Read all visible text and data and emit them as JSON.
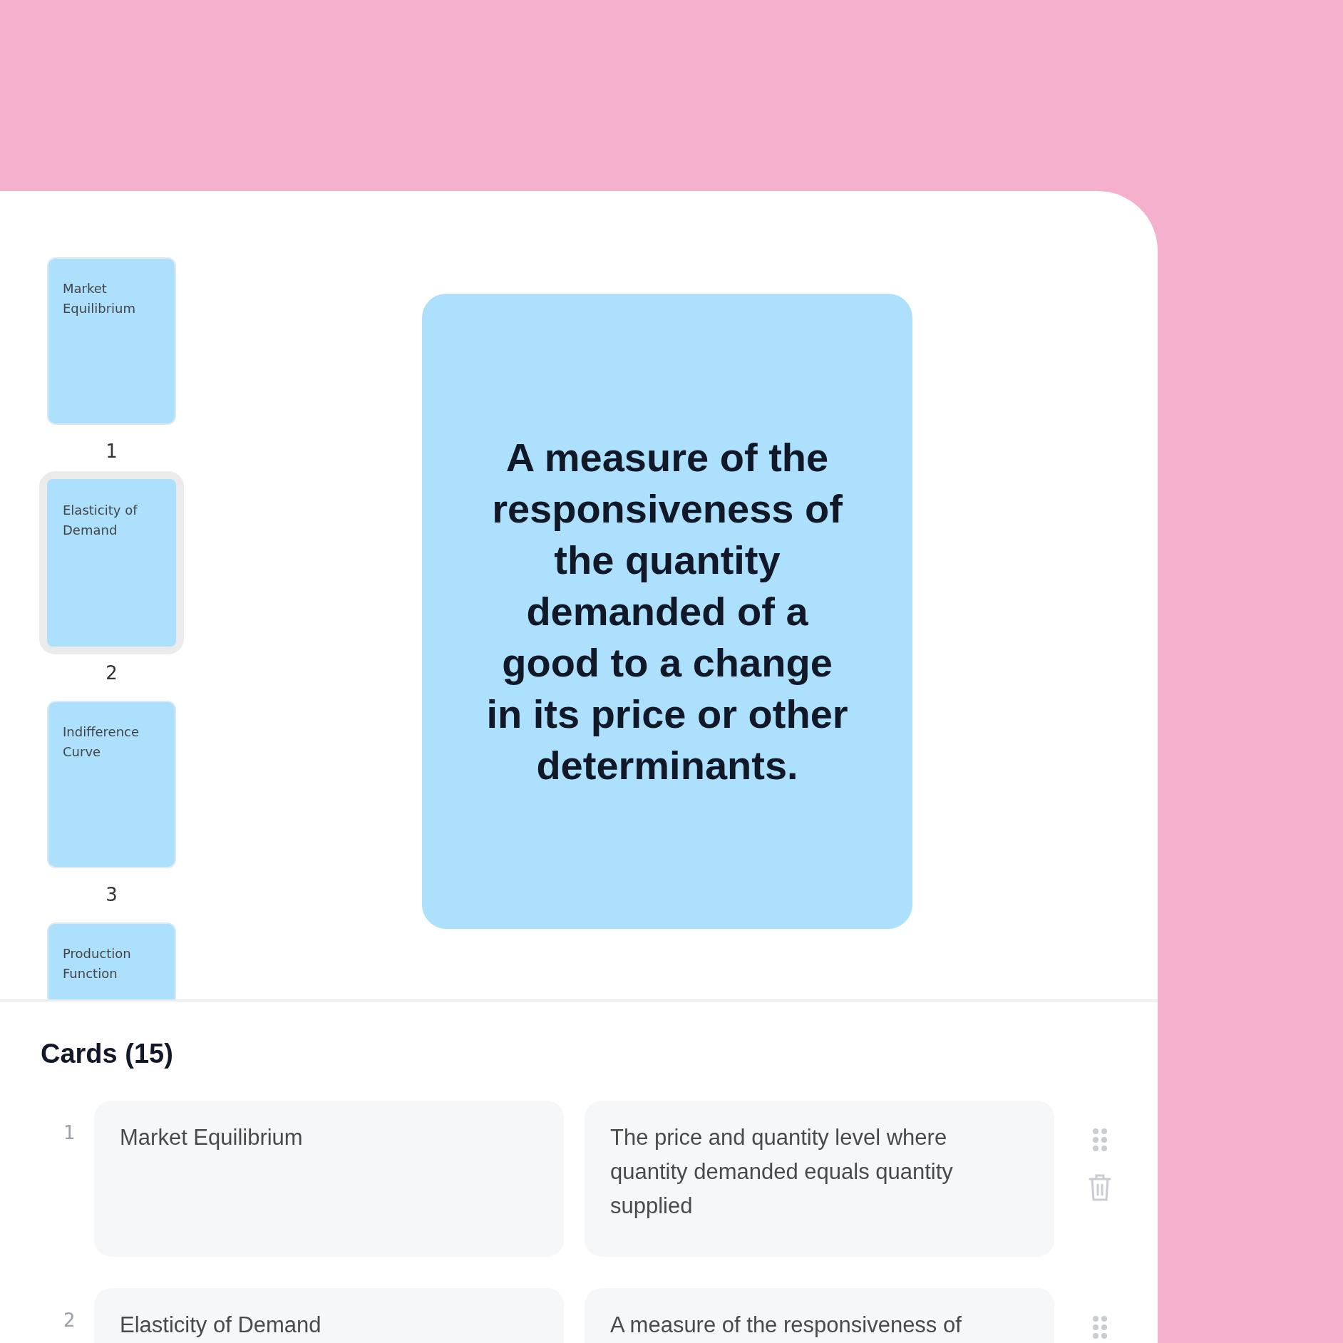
{
  "thumbnails": [
    {
      "label": "Market Equilibrium",
      "number": "1",
      "selected": false
    },
    {
      "label": "Elasticity of Demand",
      "number": "2",
      "selected": true
    },
    {
      "label": "Indifference Curve",
      "number": "3",
      "selected": false
    },
    {
      "label": "Production Function",
      "selected": false
    }
  ],
  "preview": {
    "text": "A measure of the responsiveness of the quantity demanded of a good to a change in its price or other determinants."
  },
  "cards_heading": "Cards (15)",
  "cards": [
    {
      "number": "1",
      "term": "Market Equilibrium",
      "definition": "The price and quantity level where quantity demanded equals quantity supplied"
    },
    {
      "number": "2",
      "term": "Elasticity of Demand",
      "definition": "A measure of the responsiveness of"
    }
  ]
}
